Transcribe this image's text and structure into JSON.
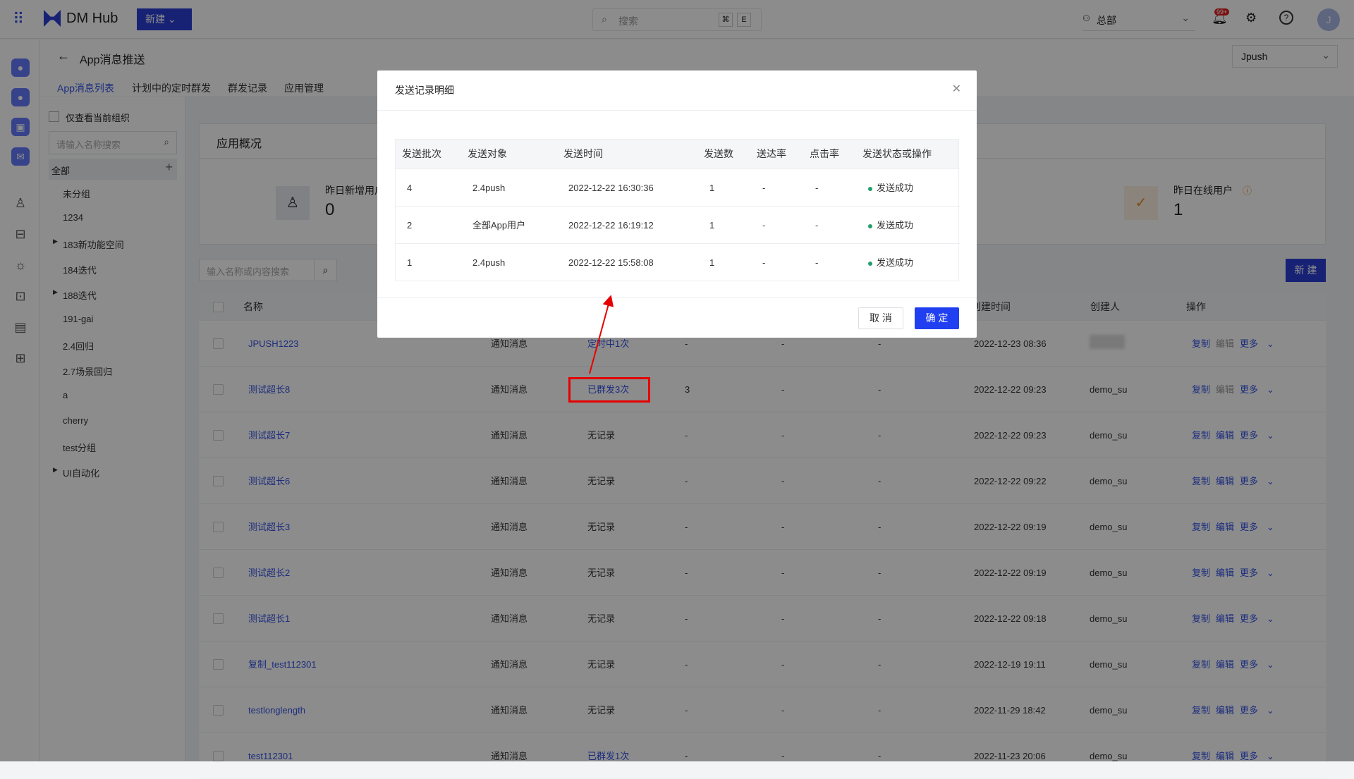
{
  "topbar": {
    "brand": "DM Hub",
    "new_label": "新建",
    "search_placeholder": "搜索",
    "kbd1": "⌘",
    "kbd2": "E",
    "org": "总部",
    "badge": "99+",
    "avatar": "J"
  },
  "page": {
    "title": "App消息推送",
    "app_select": "Jpush",
    "tabs": [
      "App消息列表",
      "计划中的定时群发",
      "群发记录",
      "应用管理"
    ]
  },
  "sidebar": {
    "only_current_org": "仅查看当前组织",
    "search_placeholder": "请输入名称搜索",
    "items": [
      "全部",
      "未分组",
      "1234",
      "183新功能空间",
      "184迭代",
      "188迭代",
      "191-gai",
      "2.4回归",
      "2.7场景回归",
      "a",
      "cherry",
      "test分组",
      "UI自动化"
    ]
  },
  "overview": {
    "title": "应用概况",
    "stat1_label": "昨日新增用户",
    "stat1_value": "0",
    "stat2_label": "昨日在线用户",
    "stat2_value": "1"
  },
  "list": {
    "search_placeholder": "输入名称或内容搜索",
    "new_label": "新 建",
    "headers": [
      "名称",
      "创建时间",
      "创建人",
      "操作"
    ],
    "ops": [
      "复制",
      "编辑",
      "更多"
    ],
    "rows": [
      {
        "name": "JPUSH1223",
        "type": "通知消息",
        "status": "定时中1次",
        "count": "-",
        "r1": "-",
        "r2": "-",
        "time": "2022-12-23 08:36",
        "creator": "",
        "status_link": true
      },
      {
        "name": "测试超长8",
        "type": "通知消息",
        "status": "已群发3次",
        "count": "3",
        "r1": "-",
        "r2": "-",
        "time": "2022-12-22 09:23",
        "creator": "demo_su",
        "status_link": true
      },
      {
        "name": "测试超长7",
        "type": "通知消息",
        "status": "无记录",
        "count": "-",
        "r1": "-",
        "r2": "-",
        "time": "2022-12-22 09:23",
        "creator": "demo_su"
      },
      {
        "name": "测试超长6",
        "type": "通知消息",
        "status": "无记录",
        "count": "-",
        "r1": "-",
        "r2": "-",
        "time": "2022-12-22 09:22",
        "creator": "demo_su"
      },
      {
        "name": "测试超长3",
        "type": "通知消息",
        "status": "无记录",
        "count": "-",
        "r1": "-",
        "r2": "-",
        "time": "2022-12-22 09:19",
        "creator": "demo_su"
      },
      {
        "name": "测试超长2",
        "type": "通知消息",
        "status": "无记录",
        "count": "-",
        "r1": "-",
        "r2": "-",
        "time": "2022-12-22 09:19",
        "creator": "demo_su"
      },
      {
        "name": "测试超长1",
        "type": "通知消息",
        "status": "无记录",
        "count": "-",
        "r1": "-",
        "r2": "-",
        "time": "2022-12-22 09:18",
        "creator": "demo_su"
      },
      {
        "name": "复制_test112301",
        "type": "通知消息",
        "status": "无记录",
        "count": "-",
        "r1": "-",
        "r2": "-",
        "time": "2022-12-19 19:11",
        "creator": "demo_su"
      },
      {
        "name": "testlonglength",
        "type": "通知消息",
        "status": "无记录",
        "count": "-",
        "r1": "-",
        "r2": "-",
        "time": "2022-11-29 18:42",
        "creator": "demo_su"
      },
      {
        "name": "test112301",
        "type": "通知消息",
        "status": "已群发1次",
        "count": "-",
        "r1": "-",
        "r2": "-",
        "time": "2022-11-23 20:06",
        "creator": "demo_su",
        "status_link": true
      }
    ]
  },
  "modal": {
    "title": "发送记录明细",
    "headers": [
      "发送批次",
      "发送对象",
      "发送时间",
      "发送数",
      "送达率",
      "点击率",
      "发送状态或操作"
    ],
    "rows": [
      {
        "batch": "4",
        "target": "2.4push",
        "time": "2022-12-22 16:30:36",
        "sent": "1",
        "delivery": "-",
        "click": "-",
        "status": "发送成功"
      },
      {
        "batch": "2",
        "target": "全部App用户",
        "time": "2022-12-22 16:19:12",
        "sent": "1",
        "delivery": "-",
        "click": "-",
        "status": "发送成功"
      },
      {
        "batch": "1",
        "target": "2.4push",
        "time": "2022-12-22 15:58:08",
        "sent": "1",
        "delivery": "-",
        "click": "-",
        "status": "发送成功"
      }
    ],
    "cancel": "取 消",
    "ok": "确 定"
  },
  "colors": {
    "accent": "#3352e6",
    "primary_button": "#1f3ff0",
    "success": "#22a06b",
    "highlight": "#e60000"
  }
}
